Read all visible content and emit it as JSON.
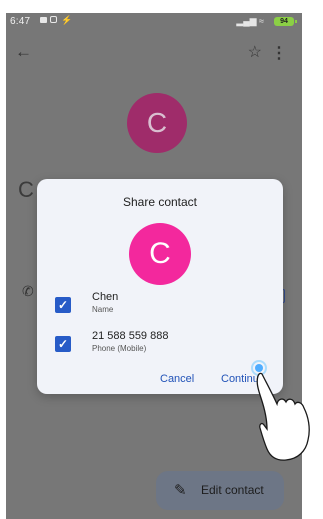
{
  "status_bar": {
    "time": "6:47",
    "battery": "94"
  },
  "background": {
    "avatar_letter": "C",
    "name_fragment": "C"
  },
  "dialog": {
    "title": "Share contact",
    "avatar_letter": "C",
    "fields": [
      {
        "value": "Chen",
        "type": "Name",
        "checked": true
      },
      {
        "value": "21 588 559 888",
        "type": "Phone (Mobile)",
        "checked": true
      }
    ],
    "cancel_label": "Cancel",
    "continue_label": "Continue"
  },
  "fab": {
    "label": "Edit contact"
  }
}
